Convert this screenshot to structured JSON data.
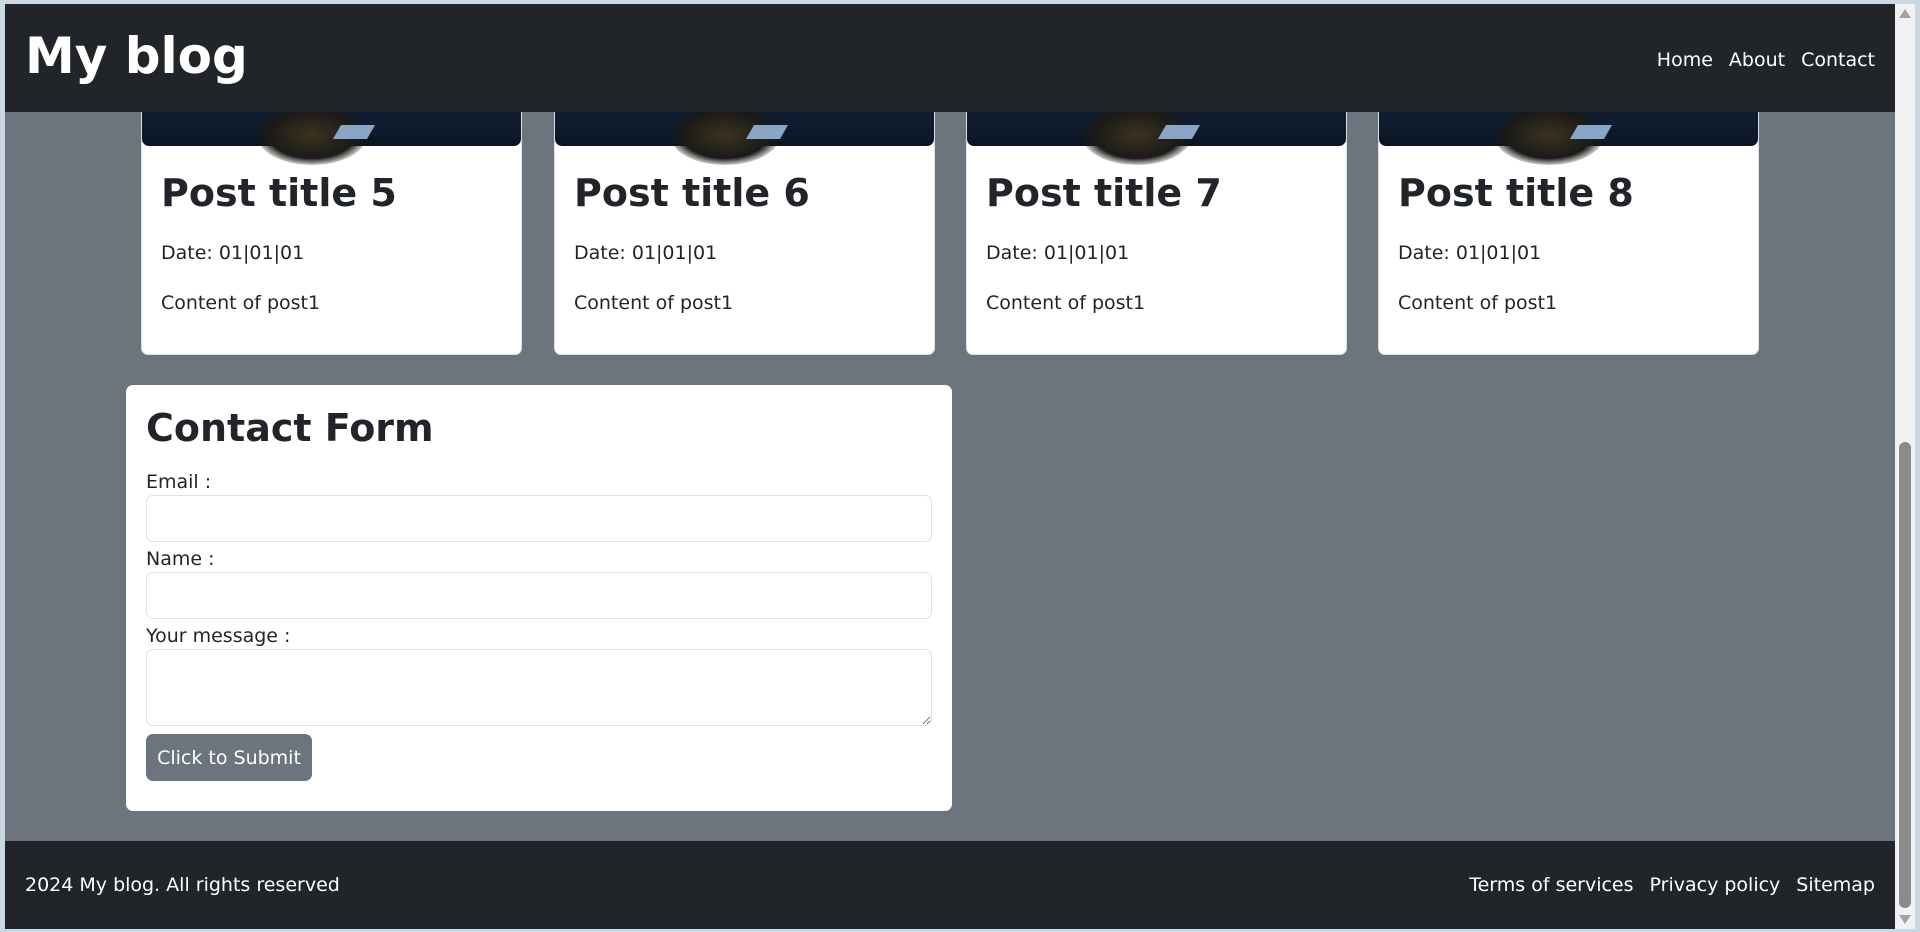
{
  "header": {
    "brand": "My blog",
    "nav": [
      "Home",
      "About",
      "Contact"
    ]
  },
  "posts": [
    {
      "title": "Post title 5",
      "date": "Date: 01|01|01",
      "content": "Content of post1"
    },
    {
      "title": "Post title 6",
      "date": "Date: 01|01|01",
      "content": "Content of post1"
    },
    {
      "title": "Post title 7",
      "date": "Date: 01|01|01",
      "content": "Content of post1"
    },
    {
      "title": "Post title 8",
      "date": "Date: 01|01|01",
      "content": "Content of post1"
    }
  ],
  "contact_form": {
    "title": "Contact Form",
    "email_label": "Email :",
    "email_value": "",
    "name_label": "Name :",
    "name_value": "",
    "message_label": "Your message :",
    "message_value": "",
    "submit_label": "Click to Submit"
  },
  "footer": {
    "copyright": "2024 My blog. All rights reserved",
    "links": [
      "Terms of services",
      "Privacy policy",
      "Sitemap"
    ]
  },
  "colors": {
    "header_bg": "#212529",
    "page_bg": "#6c757d",
    "card_bg": "#ffffff",
    "button_bg": "#6c757d"
  }
}
